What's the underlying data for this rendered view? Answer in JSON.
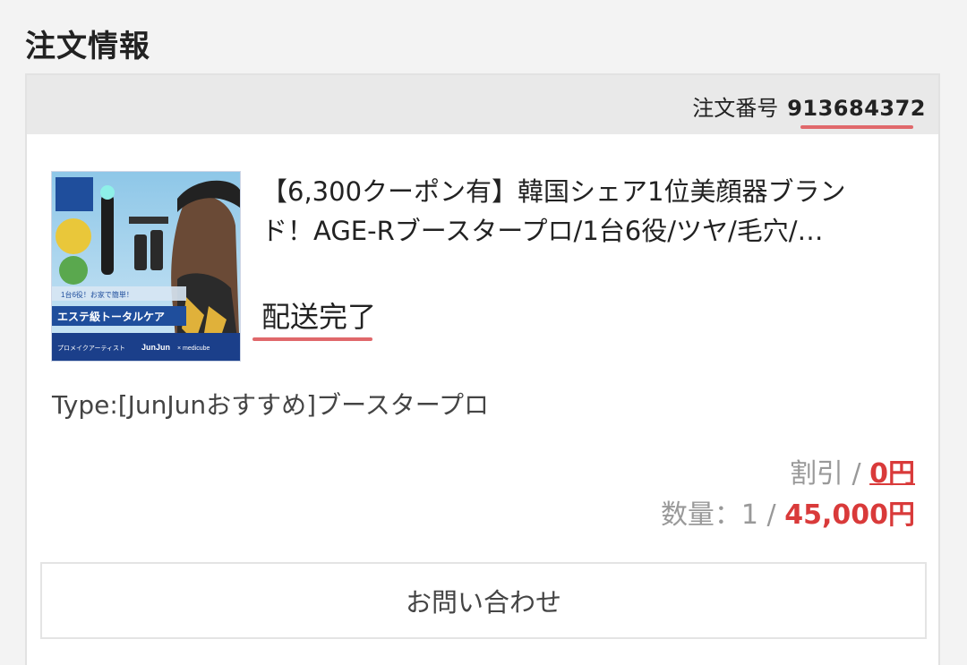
{
  "section": {
    "title": "注文情報"
  },
  "order": {
    "number_label": "注文番号",
    "number": "913684372"
  },
  "product": {
    "title_line1": "【6,300クーポン有】韓国シェア1位美顔器ブラン",
    "title_line2": "ド！AGE-Rブースタープロ/1台6役/ツヤ/毛穴/…",
    "status": "配送完了",
    "variant": "Type:[JunJunおすすめ]ブースタープロ",
    "thumbnail": {
      "caption_top": "1台6役！お家で簡単！",
      "caption_main": "エステ級トータルケア",
      "caption_bottom_prefix": "プロメイクアーティスト",
      "caption_brand": "JunJun",
      "caption_bottom_suffix": "× medicube"
    }
  },
  "pricing": {
    "discount_label": "割引 / ",
    "discount_value": "0円",
    "quantity_label": "数量：1 / ",
    "total_value": "45,000円"
  },
  "contact_button": {
    "label": "お問い合わせ"
  },
  "colors": {
    "accent_red": "#d93a3a",
    "underline_pink": "#e0686b",
    "header_gray": "#e9e9e9"
  }
}
